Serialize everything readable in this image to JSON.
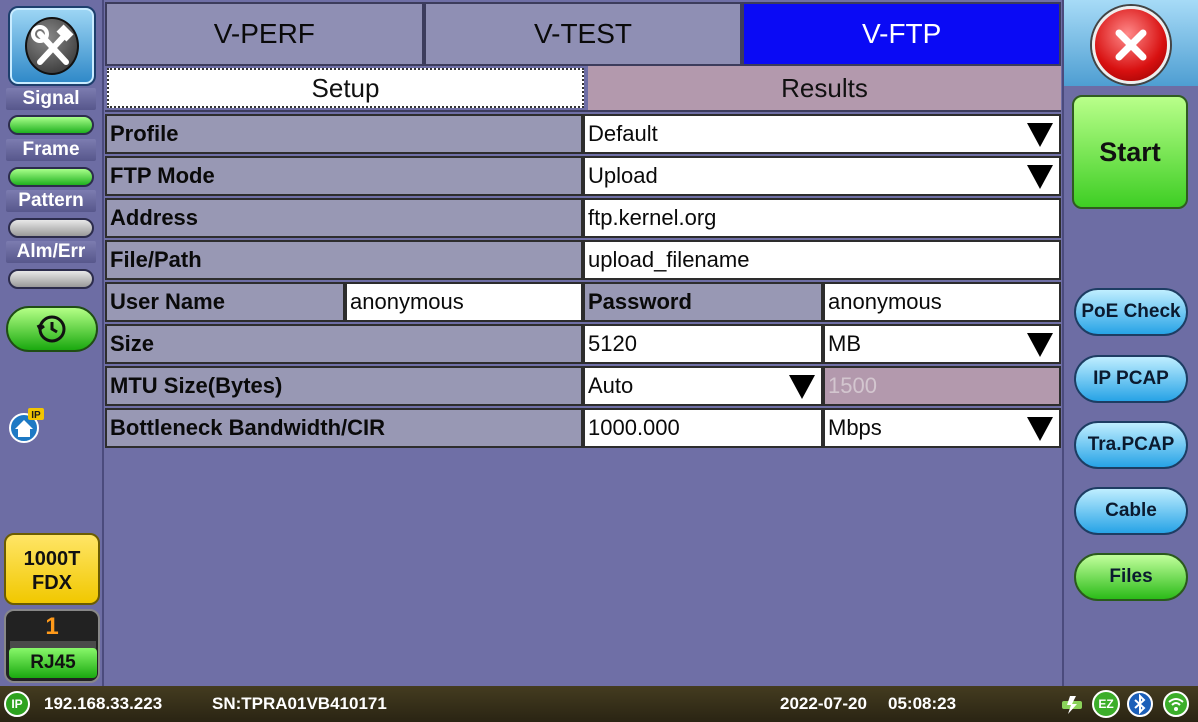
{
  "sidebar_left": {
    "indicators": [
      {
        "label": "Signal",
        "state": "green"
      },
      {
        "label": "Frame",
        "state": "green"
      },
      {
        "label": "Pattern",
        "state": "gray"
      },
      {
        "label": "Alm/Err",
        "state": "gray"
      }
    ],
    "speed": {
      "line1": "1000T",
      "line2": "FDX"
    },
    "port": {
      "number": "1",
      "label": "RJ45"
    },
    "ip_icon_text": "IP"
  },
  "tabs": [
    {
      "label": "V-PERF",
      "active": false
    },
    {
      "label": "V-TEST",
      "active": false
    },
    {
      "label": "V-FTP",
      "active": true
    }
  ],
  "subtabs": [
    {
      "label": "Setup",
      "active": true
    },
    {
      "label": "Results",
      "active": false
    }
  ],
  "form": {
    "profile": {
      "label": "Profile",
      "value": "Default"
    },
    "ftp_mode": {
      "label": "FTP Mode",
      "value": "Upload"
    },
    "address": {
      "label": "Address",
      "value": "ftp.kernel.org"
    },
    "file_path": {
      "label": "File/Path",
      "value": "upload_filename"
    },
    "user_name": {
      "label": "User Name",
      "value": "anonymous"
    },
    "password": {
      "label": "Password",
      "value": "anonymous"
    },
    "size": {
      "label": "Size",
      "value": "5120",
      "unit": "MB"
    },
    "mtu": {
      "label": "MTU Size(Bytes)",
      "value": "Auto",
      "disabled_value": "1500"
    },
    "bandwidth": {
      "label": "Bottleneck Bandwidth/CIR",
      "value": "1000.000",
      "unit": "Mbps"
    }
  },
  "sidebar_right": {
    "start_label": "Start",
    "buttons": [
      "PoE Check",
      "IP PCAP",
      "Tra.PCAP",
      "Cable",
      "Files"
    ]
  },
  "status_bar": {
    "ip_badge": "IP",
    "ip": "192.168.33.223",
    "serial": "SN:TPRA01VB410171",
    "date": "2022-07-20",
    "time": "05:08:23",
    "ez_label": "EZ"
  },
  "colors": {
    "background": "#6f6fa6",
    "active_tab": "#0a0af5",
    "label_cell": "#9898b4",
    "results_tab": "#b399ad",
    "start_green": "#3ece24"
  }
}
